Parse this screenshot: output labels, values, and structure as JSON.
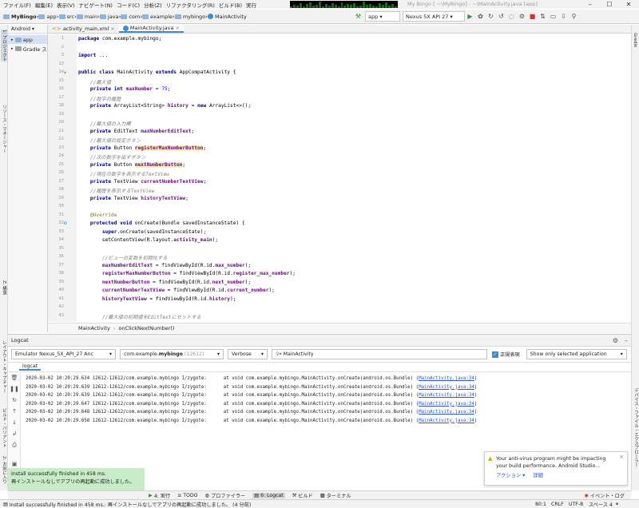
{
  "menu": [
    "ファイル(F)",
    "編集(E)",
    "表示(V)",
    "ナビゲート(N)",
    "コード(C)",
    "分析(Z)",
    "リファクタリング(R)",
    "ビルド(B)",
    "実行"
  ],
  "window_title": "My Bingo [ ~\\MyBingo] - ~\\MainActivity.java [app]",
  "breadcrumb": [
    "MyBingo",
    "app",
    "src",
    "main",
    "java",
    "com",
    "example",
    "mybingo",
    "MainActivity"
  ],
  "run_config": "app",
  "device": "Nexus 5X API 27",
  "project_view": "Android",
  "project_items": [
    "app",
    "Gradle ス"
  ],
  "left_tool_labels": [
    "1: プロジェクト",
    "リソース・マネージャー",
    "Z: 構造",
    "レイアウト・キャプチャー",
    "ビルド・バリアント",
    "2: お気に入り"
  ],
  "right_tool_labels": [
    "Gradle",
    "デバイス・ファイル・エクスプローラー"
  ],
  "tabs": [
    "activity_main.xml",
    "MainActivity.java"
  ],
  "code_lines": [
    {
      "n": "1",
      "parts": [
        [
          "kw",
          "package "
        ],
        [
          "",
          "com.example.mybingo;"
        ]
      ]
    },
    {
      "n": "2",
      "parts": []
    },
    {
      "n": "3",
      "parts": [
        [
          "kw",
          "import "
        ],
        [
          "",
          "..."
        ]
      ]
    },
    {
      "n": "13",
      "parts": []
    },
    {
      "n": "14",
      "parts": [
        [
          "kw",
          "public class "
        ],
        [
          "",
          "MainActivity "
        ],
        [
          "kw",
          "extends "
        ],
        [
          "",
          "AppCompatActivity {"
        ]
      ]
    },
    {
      "n": "15",
      "parts": [
        [
          "",
          "    "
        ],
        [
          "cm",
          "//最大値"
        ]
      ]
    },
    {
      "n": "16",
      "parts": [
        [
          "",
          "    "
        ],
        [
          "kw",
          "private int "
        ],
        [
          "fd",
          "maxNumber"
        ],
        [
          "",
          " = "
        ],
        [
          "nm",
          "75"
        ],
        [
          "",
          ";"
        ]
      ]
    },
    {
      "n": "17",
      "parts": [
        [
          "",
          "    "
        ],
        [
          "cm",
          "//数字の履歴"
        ]
      ]
    },
    {
      "n": "18",
      "parts": [
        [
          "",
          "    "
        ],
        [
          "kw",
          "private "
        ],
        [
          "",
          "ArrayList<String> "
        ],
        [
          "fd",
          "history"
        ],
        [
          "",
          " = "
        ],
        [
          "kw",
          "new "
        ],
        [
          "",
          "ArrayList<>();"
        ]
      ]
    },
    {
      "n": "19",
      "parts": []
    },
    {
      "n": "20",
      "parts": [
        [
          "",
          "    "
        ],
        [
          "cm",
          "//最大値の入力欄"
        ]
      ]
    },
    {
      "n": "21",
      "parts": [
        [
          "",
          "    "
        ],
        [
          "kw",
          "private "
        ],
        [
          "",
          "EditText "
        ],
        [
          "fd",
          "maxNumberEditText"
        ],
        [
          "",
          ";"
        ]
      ]
    },
    {
      "n": "22",
      "parts": [
        [
          "",
          "    "
        ],
        [
          "cm",
          "//最大値の設定ボタン"
        ]
      ]
    },
    {
      "n": "23",
      "parts": [
        [
          "",
          "    "
        ],
        [
          "kw",
          "private "
        ],
        [
          "",
          "Button "
        ],
        [
          "fd hl",
          "registerMaxNumberButton"
        ],
        [
          "",
          ";"
        ]
      ]
    },
    {
      "n": "24",
      "parts": [
        [
          "",
          "    "
        ],
        [
          "cm",
          "//次の数字を出すボタン"
        ]
      ]
    },
    {
      "n": "25",
      "parts": [
        [
          "",
          "    "
        ],
        [
          "kw",
          "private "
        ],
        [
          "",
          "Button "
        ],
        [
          "fd hl",
          "nextNumberButton"
        ],
        [
          "",
          ";"
        ]
      ]
    },
    {
      "n": "26",
      "parts": [
        [
          "",
          "    "
        ],
        [
          "cm",
          "//現在の数字を表示するTextView"
        ]
      ]
    },
    {
      "n": "27",
      "parts": [
        [
          "",
          "    "
        ],
        [
          "kw",
          "private "
        ],
        [
          "",
          "TextView "
        ],
        [
          "fd",
          "currentNumberTextView"
        ],
        [
          "",
          ";"
        ]
      ]
    },
    {
      "n": "28",
      "parts": [
        [
          "",
          "    "
        ],
        [
          "cm",
          "//履歴を表示するTextView"
        ]
      ]
    },
    {
      "n": "29",
      "parts": [
        [
          "",
          "    "
        ],
        [
          "kw",
          "private "
        ],
        [
          "",
          "TextView "
        ],
        [
          "fd",
          "historyTextView"
        ],
        [
          "",
          ";"
        ]
      ]
    },
    {
      "n": "30",
      "parts": []
    },
    {
      "n": "31",
      "parts": [
        [
          "",
          "    "
        ],
        [
          "an",
          "@Override"
        ]
      ]
    },
    {
      "n": "32",
      "parts": [
        [
          "",
          "    "
        ],
        [
          "kw",
          "protected void "
        ],
        [
          "",
          "onCreate(Bundle savedInstanceState) {"
        ]
      ]
    },
    {
      "n": "33",
      "parts": [
        [
          "",
          "        "
        ],
        [
          "kw",
          "super"
        ],
        [
          "",
          ".onCreate(savedInstanceState);"
        ]
      ]
    },
    {
      "n": "34",
      "parts": [
        [
          "",
          "        setContentView(R.layout."
        ],
        [
          "fd",
          "activity_main"
        ],
        [
          "",
          ");"
        ]
      ]
    },
    {
      "n": "35",
      "parts": []
    },
    {
      "n": "36",
      "parts": [
        [
          "",
          "        "
        ],
        [
          "cm",
          "//ビューの変数を初期化する"
        ]
      ]
    },
    {
      "n": "37",
      "parts": [
        [
          "",
          "        "
        ],
        [
          "fd",
          "maxNumberEditText"
        ],
        [
          "",
          " = findViewById(R.id."
        ],
        [
          "fd",
          "max_number"
        ],
        [
          "",
          ");"
        ]
      ]
    },
    {
      "n": "38",
      "parts": [
        [
          "",
          "        "
        ],
        [
          "fd",
          "registerMaxNumberButton"
        ],
        [
          "",
          " = findViewById(R.id."
        ],
        [
          "fd",
          "register_max_number"
        ],
        [
          "",
          ");"
        ]
      ]
    },
    {
      "n": "39",
      "parts": [
        [
          "",
          "        "
        ],
        [
          "fd",
          "nextNumberButton"
        ],
        [
          "",
          " = findViewById(R.id."
        ],
        [
          "fd",
          "next_number"
        ],
        [
          "",
          ");"
        ]
      ]
    },
    {
      "n": "40",
      "parts": [
        [
          "",
          "        "
        ],
        [
          "fd",
          "currentNumberTextView"
        ],
        [
          "",
          " = findViewById(R.id."
        ],
        [
          "fd",
          "current_number"
        ],
        [
          "",
          ");"
        ]
      ]
    },
    {
      "n": "41",
      "parts": [
        [
          "",
          "        "
        ],
        [
          "fd",
          "historyTextView"
        ],
        [
          "",
          " = findViewById(R.id."
        ],
        [
          "fd",
          "history"
        ],
        [
          "",
          ");"
        ]
      ]
    },
    {
      "n": "42",
      "parts": []
    },
    {
      "n": "43",
      "parts": [
        [
          "",
          "        "
        ],
        [
          "cm",
          "//最大値の初期値をEditTextにセットする"
        ]
      ]
    }
  ],
  "editor_breadcrumb": [
    "MainActivity",
    "onClickNextNumber()"
  ],
  "logcat": {
    "title": "Logcat",
    "device": "Emulator Nexus_5X_API_27 Anc",
    "process": "com.example.",
    "process_bold": "mybingo",
    "process_pid": " (12612)",
    "level": "Verbose",
    "search": "MainActivity",
    "regex_label": "正規表現",
    "filter": "Show only selected application",
    "subtab": "logcat",
    "lines": [
      {
        "prefix": "2020-03-02 10:20:29.634 12612-12612/com.example.mybingo I/zygote:      at void com.example.mybingo.MainActivity.onCreate(android.os.Bundle) (",
        "link": "MainActivity.java:34",
        "suffix": ")"
      },
      {
        "prefix": "2020-03-02 10:20:29.639 12612-12612/com.example.mybingo I/zygote:      at void com.example.mybingo.MainActivity.onCreate(android.os.Bundle) (",
        "link": "MainActivity.java:34",
        "suffix": ")"
      },
      {
        "prefix": "2020-03-02 10:20:29.639 12612-12612/com.example.mybingo I/zygote:      at void com.example.mybingo.MainActivity.onCreate(android.os.Bundle) (",
        "link": "MainActivity.java:34",
        "suffix": ")"
      },
      {
        "prefix": "2020-03-02 10:20:29.647 12612-12612/com.example.mybingo I/zygote:      at void com.example.mybingo.MainActivity.onCreate(android.os.Bundle) (",
        "link": "MainActivity.java:34",
        "suffix": ")"
      },
      {
        "prefix": "2020-03-02 10:20:29.648 12612-12612/com.example.mybingo I/zygote:      at void com.example.mybingo.MainActivity.onCreate(android.os.Bundle) (",
        "link": "MainActivity.java:34",
        "suffix": ")"
      },
      {
        "prefix": "2020-03-02 10:20:29.658 12612-12612/com.example.mybingo I/zygote:      at void com.example.mybingo.MainActivity.onCreate(android.os.Bundle) (",
        "link": "MainActivity.java:34",
        "suffix": ")"
      }
    ]
  },
  "toast": {
    "line1": "Install successfully finished in 458 ms.",
    "line2": "再インストールなしでアプリの再起動に成功しました。"
  },
  "antivirus": {
    "line1": "Your anti-virus program might be impacting",
    "line2": "your build performance. Android Studio...",
    "action": "アクション",
    "detail": "詳細"
  },
  "bottom_tools": [
    "4: 実行",
    "TODO",
    "プロファイラー",
    "6: Logcat",
    "ビルド",
    "ターミナル"
  ],
  "event_log": "イベント・ログ",
  "status": {
    "message": "Install successfully finished in 458 ms.: 再インストールなしでアプリの再起動に成功しました。 (4 分前)",
    "pos": "80:1",
    "crlf": "CRLF",
    "enc": "UTF-8",
    "indent": "スペース 4"
  }
}
